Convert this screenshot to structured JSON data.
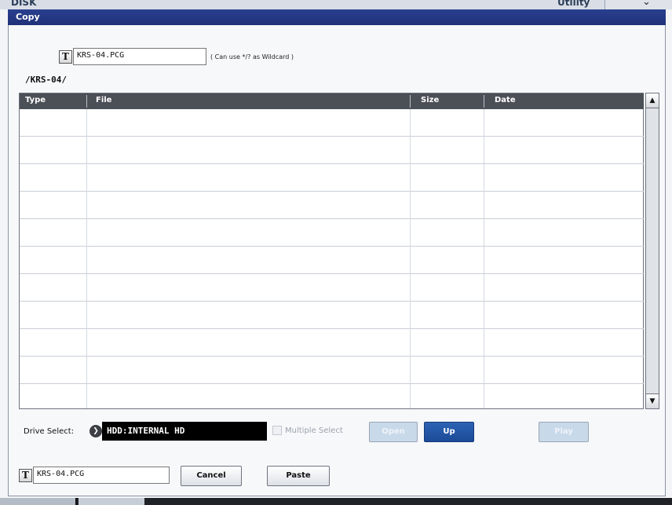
{
  "background": {
    "title": "DISK",
    "utility_label": "Utility"
  },
  "dialog": {
    "title": "Copy",
    "filter": {
      "t_label": "T",
      "value": "KRS-04.PCG",
      "hint": "( Can use */? as Wildcard )"
    },
    "path": "/KRS-04/",
    "table": {
      "columns": [
        "Type",
        "File",
        "Size",
        "Date"
      ],
      "rows": [
        [
          "",
          "",
          "",
          ""
        ],
        [
          "",
          "",
          "",
          ""
        ],
        [
          "",
          "",
          "",
          ""
        ],
        [
          "",
          "",
          "",
          ""
        ],
        [
          "",
          "",
          "",
          ""
        ],
        [
          "",
          "",
          "",
          ""
        ],
        [
          "",
          "",
          "",
          ""
        ],
        [
          "",
          "",
          "",
          ""
        ],
        [
          "",
          "",
          "",
          ""
        ],
        [
          "",
          "",
          "",
          ""
        ],
        [
          "",
          "",
          "",
          ""
        ]
      ]
    },
    "drive": {
      "label": "Drive Select:",
      "value": "HDD:INTERNAL HD"
    },
    "multiple_select": {
      "label": "Multiple Select",
      "checked": false
    },
    "buttons": {
      "open": "Open",
      "up": "Up",
      "play": "Play",
      "cancel": "Cancel",
      "paste": "Paste"
    },
    "dest": {
      "t_label": "T",
      "value": "KRS-04.PCG"
    }
  },
  "colors": {
    "titlebar": "#22378a",
    "accent_button": "#1f4f9e",
    "header_row": "#4b4f56"
  }
}
